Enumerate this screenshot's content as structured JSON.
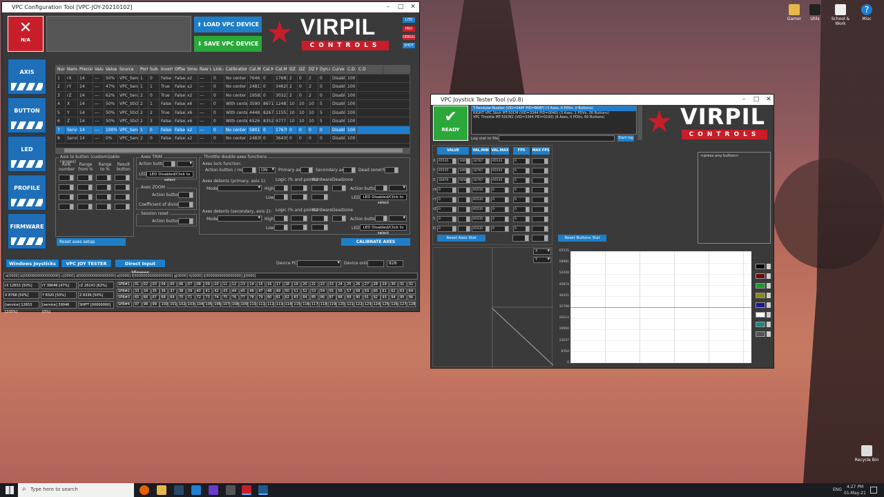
{
  "vpc_config": {
    "title": "VPC Configuration Tool [VPC-JOY-20210102]",
    "status": "N/A",
    "load_label": "LOAD VPC DEVICE",
    "save_label": "SAVE VPC DEVICE",
    "brand": "VIRPIL",
    "brand_sub": "CONTROLS",
    "badges": [
      "LITE",
      "PRO",
      "DEBUG",
      "SHOT"
    ],
    "sidebar": [
      "AXIS",
      "BUTTON",
      "LED",
      "PROFILE",
      "FIRMWARE"
    ],
    "table_headers": [
      "Num",
      "Name",
      "Precision",
      "Value",
      "Value(%)",
      "Source",
      "Port",
      "Sub.Port",
      "Inverted",
      "Offset",
      "Smooth",
      "Raw Value",
      "Link.cmt",
      "Calibration",
      "Cal.Min",
      "Cal.Mid",
      "Cal.Max",
      "DZ Min",
      "DZ Mid",
      "DZ Max",
      "Dyn.DZ",
      "Curve",
      "C.D.L",
      "C.D"
    ],
    "rows": [
      [
        "1",
        "rX",
        "14",
        "---",
        "50%",
        "VPC_Sens",
        "1",
        "0",
        "False",
        "False",
        "x2",
        "---",
        "0",
        "No center",
        "7646",
        "0",
        "17681",
        "2",
        "0",
        "2",
        "0",
        "Disabled",
        "100"
      ],
      [
        "2",
        "rY",
        "14",
        "---",
        "47%",
        "VPC_Sens",
        "1",
        "1",
        "True",
        "False",
        "x2",
        "---",
        "0",
        "No center",
        "24817",
        "0",
        "34629",
        "2",
        "0",
        "2",
        "0",
        "Disabled",
        "100"
      ],
      [
        "3",
        "rZ",
        "14",
        "---",
        "62%",
        "VPC_Sens",
        "2",
        "0",
        "True",
        "False",
        "x2",
        "---",
        "0",
        "No center",
        "19583",
        "0",
        "30323",
        "2",
        "0",
        "2",
        "0",
        "Disabled",
        "100"
      ],
      [
        "4",
        "X",
        "14",
        "---",
        "50%",
        "VPC_Stick",
        "2",
        "1",
        "False",
        "False",
        "x6",
        "---",
        "0",
        "With center",
        "3590",
        "8671",
        "12481",
        "10",
        "10",
        "10",
        "5",
        "Disabled",
        "100"
      ],
      [
        "5",
        "Y",
        "14",
        "---",
        "50%",
        "VPC_Stick",
        "2",
        "2",
        "True",
        "False",
        "x6",
        "---",
        "0",
        "With center",
        "4448",
        "8267",
        "11553",
        "10",
        "10",
        "10",
        "5",
        "Disabled",
        "100"
      ],
      [
        "6",
        "Z",
        "14",
        "---",
        "50%",
        "VPC_Stick",
        "2",
        "3",
        "False",
        "False",
        "x6",
        "---",
        "0",
        "With center",
        "6526",
        "8352",
        "9777",
        "10",
        "10",
        "10",
        "5",
        "Disabled",
        "100"
      ],
      [
        "7",
        "Service",
        "14",
        "---",
        "100%",
        "VPC_Sens",
        "1",
        "0",
        "False",
        "False",
        "x2",
        "---",
        "0",
        "No center",
        "5801",
        "0",
        "17679",
        "0",
        "0",
        "0",
        "0",
        "Disabled",
        "100"
      ],
      [
        "8",
        "Service",
        "14",
        "---",
        "0%",
        "VPC_Sens",
        "2",
        "0",
        "False",
        "False",
        "x2",
        "---",
        "0",
        "No center",
        "24839",
        "0",
        "36435",
        "0",
        "0",
        "0",
        "0",
        "Disabled",
        "100"
      ]
    ],
    "axis_to_button": {
      "title": "Axis to button (customizable ranges)",
      "cols": [
        "Axis number",
        "Range from %",
        "Range to %",
        "Result button"
      ]
    },
    "trim": {
      "title": "Axes TRIM",
      "action": "Action button",
      "led": "LED",
      "led_btn": "LED Disabled/Click to select"
    },
    "zoom": {
      "title": "Axes ZOOM",
      "action": "Action button",
      "coef": "Coefficient of division"
    },
    "session": {
      "title": "Session reset",
      "action": "Action button"
    },
    "throttle": {
      "title": "Throttle double axes functions",
      "lock": "Axes lock function:",
      "action_mode": "Action button / mode",
      "on": "ON",
      "primary": "Primary axis",
      "secondary": "Secondary axis",
      "deadzone": "Dead zone(%)",
      "det1": "Axes detents (primary, axis 1):",
      "det2": "Axes detents (secondary, axis 2):",
      "mode": "Mode",
      "high": "High",
      "low": "Low",
      "logic": "Logic (% and points)",
      "hardware": "Hardware",
      "dz": "Deadzone",
      "action": "Action button",
      "led": "LED",
      "led_btn": "LED Disabled/Click to select"
    },
    "reset_axes": "Reset axes setup",
    "calibrate": "CALIBRATE AXES",
    "tabs": [
      "Windows Joysticks",
      "VPC JOY TESTER",
      "Direct Input Viewer"
    ],
    "device_pcb": "Device PCB",
    "device_online": "Device online",
    "device_online_val": "828",
    "bits_line": "a[0000] b[0000000000000000] c[0000] d[0000000000000000] e[0000] f[00000000000000000] g[0000] h[0000] i[0000000000000000] j[0000]",
    "axis_status": [
      "rX 12653 [50%]",
      "rY 39046 [47%]",
      "rZ 26143 [62%]",
      "X 8768 [50%]",
      "Y 8320 [50%]",
      "Z 8336 [50%]",
      "[service] 12653 [100%]",
      "[service] 39046 [0%]",
      "SHIFT [00000000]"
    ],
    "banks": [
      "SPB#1",
      "SPB#2",
      "SPB#3",
      "SPB#4"
    ]
  },
  "tester": {
    "title": "VPC Joystick Tester Tool (v0.8)",
    "ready": "READY",
    "devices": [
      "T-Pendular-Rudder (VID=044F PID=B68F) (3 Axes, 0 POVs, 0 Buttons)",
      "RIGHT VPC Stick MT-50CM (VID=3344 PID=0040) (3 Axes, 1 POVs, 28 Buttons)",
      "VPC Throttle MT-50CM2 (VID=3344 PID=0193) (6 Axes, 0 POVs, 60 Buttons)"
    ],
    "log_label": "Log stat to file:",
    "start_log": "Start log",
    "brand": "VIRPIL",
    "brand_sub": "CONTROLS",
    "cols": [
      "VALUE",
      "VAL.MIN",
      "VAL.MAX",
      "FPS",
      "MAX FPS"
    ],
    "axes": [
      "X",
      "Y",
      "Z",
      "rX",
      "rY",
      "rZ",
      "S",
      "D"
    ],
    "values": [
      [
        "65535",
        "100%",
        "32767",
        "65535",
        "0"
      ],
      [
        "65535",
        "100%",
        "32767",
        "65535",
        "0"
      ],
      [
        "32670",
        "50%",
        "32767",
        "65535",
        "0"
      ],
      [
        "0",
        "",
        "65535",
        "0",
        "0"
      ],
      [
        "0",
        "",
        "65535",
        "0",
        "0"
      ],
      [
        "0",
        "",
        "65535",
        "0",
        "0"
      ],
      [
        "0",
        "",
        "65535",
        "0",
        "0"
      ],
      [
        "0",
        "",
        "65535",
        "0",
        "0"
      ]
    ],
    "reset_axes": "Reset Axes Stat",
    "reset_buttons": "Reset Buttons Stat",
    "press": "<press any button>",
    "graph_x": "X",
    "graph_y": "Y",
    "y_ticks": [
      "65535",
      "58981",
      "52428",
      "45874",
      "39321",
      "32768",
      "26214",
      "19660",
      "13107",
      "6554",
      "0"
    ]
  },
  "desktop": {
    "icons": [
      "Gamer",
      "Utils",
      "School & Work",
      "Misc"
    ],
    "recycle": "Recycle Bin",
    "search": "Type here to search",
    "time": "4:27 PM",
    "date": "01-May-21",
    "lang": "ENG"
  }
}
